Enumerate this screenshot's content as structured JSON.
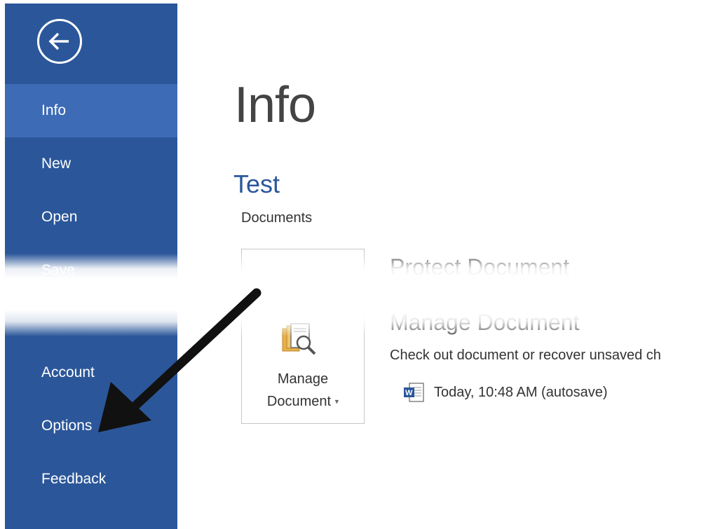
{
  "sidebar": {
    "items": [
      {
        "label": "Info",
        "active": true
      },
      {
        "label": "New",
        "active": false
      },
      {
        "label": "Open",
        "active": false
      },
      {
        "label": "Save",
        "active": false
      },
      {
        "label": "Account",
        "active": false
      },
      {
        "label": "Options",
        "active": false
      },
      {
        "label": "Feedback",
        "active": false
      }
    ],
    "back_icon": "back-arrow-circle-icon"
  },
  "main": {
    "title": "Info",
    "doc_name": "Test",
    "doc_location": "Documents",
    "protect": {
      "heading": "Protect Document"
    },
    "manage": {
      "tile_label_line1": "Manage",
      "tile_label_line2": "Document",
      "heading": "Manage Document",
      "description": "Check out document or recover unsaved ch",
      "autosave_entry": "Today, 10:48 AM (autosave)",
      "icon": "manage-document-icon"
    }
  },
  "colors": {
    "sidebar_bg": "#2b579a",
    "sidebar_active": "#3d6bb5",
    "accent_blue": "#2b579a"
  }
}
